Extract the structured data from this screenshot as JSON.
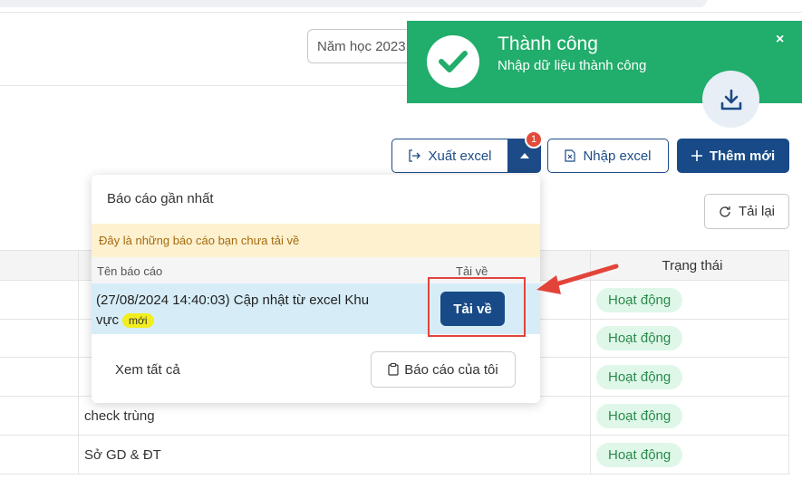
{
  "filters": {
    "year_select": "Năm học 2023"
  },
  "toolbar": {
    "export_label": "Xuất excel",
    "export_badge": "1",
    "import_label": "Nhập excel",
    "add_label": "Thêm mới",
    "reload_label": "Tải lại"
  },
  "table": {
    "status_header": "Trạng thái",
    "rows": [
      {
        "name": "",
        "status": "Hoạt động"
      },
      {
        "name": "",
        "status": "Hoạt động"
      },
      {
        "name": "",
        "status": "Hoạt động"
      },
      {
        "name": "check trùng",
        "status": "Hoạt động"
      },
      {
        "name": "Sở GD & ĐT",
        "status": "Hoạt động"
      }
    ]
  },
  "dropdown": {
    "title": "Báo cáo gần nhất",
    "notice": "Đây là những báo cáo bạn chưa tải về",
    "col_name": "Tên báo cáo",
    "col_download": "Tải về",
    "item": {
      "text": "(27/08/2024 14:40:03) Cập nhật từ excel Khu vực",
      "tag": "mới",
      "download_label": "Tải về"
    },
    "view_all": "Xem tất cả",
    "my_reports": "Báo cáo của tôi"
  },
  "toast": {
    "title": "Thành công",
    "message": "Nhập dữ liệu thành công",
    "close": "×",
    "progress": 1.0
  },
  "colors": {
    "primary": "#174a86",
    "success": "#21ad6b",
    "badge": "#e24a3b",
    "highlight": "#e2443a",
    "status_bg": "#dff7e8",
    "status_text": "#2a8a4d",
    "notice_bg": "#fdf1cf",
    "tag_bg": "#f2ee1f"
  }
}
